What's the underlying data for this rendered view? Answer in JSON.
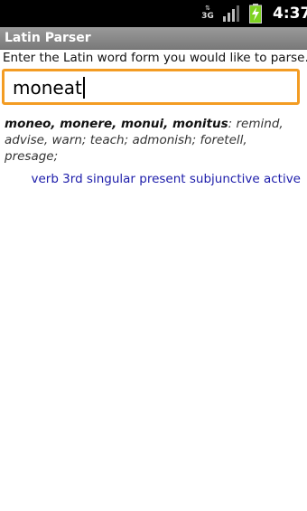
{
  "status_bar": {
    "network_label": "3G",
    "signal_icon": "signal-bars-icon",
    "battery_icon": "battery-charging-icon",
    "time": "4:37",
    "battery_color": "#7ed321"
  },
  "app": {
    "title": "Latin Parser"
  },
  "form": {
    "prompt": "Enter the Latin word form you would like to parse.",
    "input_value": "moneat",
    "accent_color": "#f39c23"
  },
  "result": {
    "principal_parts": "moneo, monere, monui, monitus",
    "meaning": ": remind, advise, warn; teach; admonish; foretell, presage;",
    "parse": "verb 3rd singular present subjunctive active",
    "parse_color": "#1c1caa"
  }
}
